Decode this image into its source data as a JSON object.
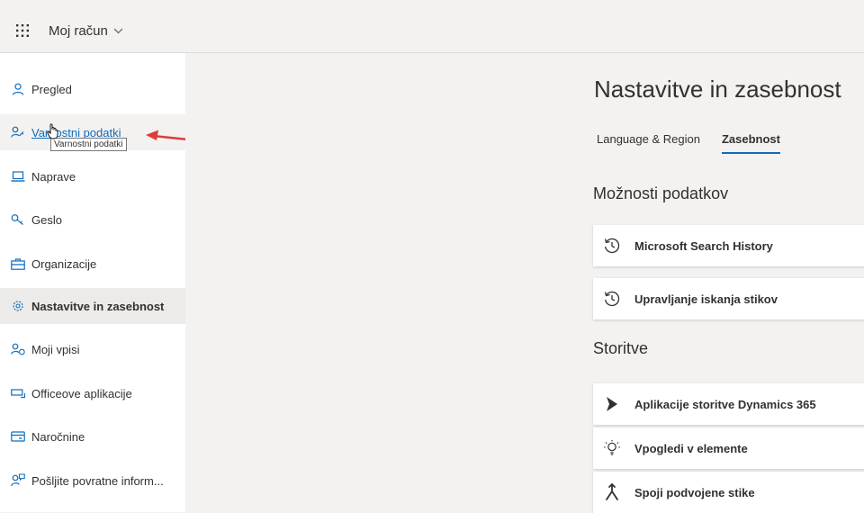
{
  "header": {
    "app_title": "Moj račun"
  },
  "sidebar": {
    "items": [
      {
        "label": "Pregled",
        "icon": "person-icon"
      },
      {
        "label": "Varnostni podatki",
        "icon": "person-key-icon",
        "state": "hover"
      },
      {
        "label": "Naprave",
        "icon": "laptop-icon"
      },
      {
        "label": "Geslo",
        "icon": "key-icon"
      },
      {
        "label": "Organizacije",
        "icon": "briefcase-icon"
      },
      {
        "label": "Nastavitve in zasebnost",
        "icon": "gear-icon",
        "state": "active"
      },
      {
        "label": "Moji vpisi",
        "icon": "person-sync-icon"
      },
      {
        "label": "Officeove aplikacije",
        "icon": "office-apps-icon"
      },
      {
        "label": "Naročnine",
        "icon": "card-icon"
      },
      {
        "label": "Pošljite povratne inform...",
        "icon": "feedback-icon"
      }
    ]
  },
  "tooltip": {
    "text": "Varnostni podatki"
  },
  "main": {
    "title": "Nastavitve in zasebnost",
    "tabs": [
      {
        "label": "Language & Region",
        "selected": false
      },
      {
        "label": "Zasebnost",
        "selected": true
      }
    ],
    "data_section": {
      "title": "Možnosti podatkov",
      "items": [
        {
          "label": "Microsoft Search History",
          "icon": "history-icon"
        },
        {
          "label": "Upravljanje iskanja stikov",
          "icon": "history-icon"
        }
      ]
    },
    "services_section": {
      "title": "Storitve",
      "items": [
        {
          "label": "Aplikacije storitve Dynamics 365",
          "icon": "dynamics-icon"
        },
        {
          "label": "Vpogledi v elemente",
          "icon": "lightbulb-icon"
        },
        {
          "label": "Spoji podvojene stike",
          "icon": "merge-icon"
        }
      ]
    }
  },
  "colors": {
    "accent": "#0f6cbd",
    "annotation_arrow": "#e03a3a",
    "background": "#f3f2f1"
  }
}
